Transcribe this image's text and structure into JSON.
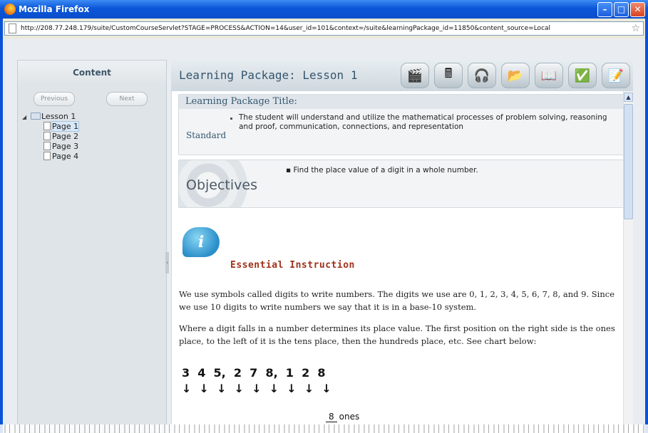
{
  "window": {
    "title": "Mozilla Firefox",
    "minimize": "–",
    "maximize": "□",
    "close": "✕"
  },
  "address_bar": {
    "url": "http://208.77.248.179/suite/CustomCourseServlet?STAGE=PROCESS&ACTION=14&user_id=101&context=/suite&learningPackage_id=11850&content_source=Local"
  },
  "sidebar": {
    "heading": "Content",
    "previous_label": "Previous",
    "next_label": "Next",
    "tree": {
      "lesson": "Lesson 1",
      "pages": [
        "Page 1",
        "Page 2",
        "Page 3",
        "Page 4"
      ],
      "selected_page": "Page 1"
    }
  },
  "header": {
    "title": "Learning Package: Lesson 1",
    "tools": [
      "clapperboard-icon",
      "calculator-icon",
      "headphones-icon",
      "folder-icon",
      "book-pdf-icon",
      "check-mail-icon",
      "notepad-icon"
    ]
  },
  "standard_card": {
    "title": "Learning Package Title:",
    "label": "Standard",
    "text": "The student will understand and utilize the mathematical processes of problem solving, reasoning and proof, communication, connections, and representation"
  },
  "objectives_card": {
    "label": "Objectives",
    "items": [
      "Find the place value of a digit in a whole number."
    ]
  },
  "instruction": {
    "heading": "Essential Instruction",
    "paragraph1": "We use symbols called digits to write numbers.  The digits we use are 0, 1, 2, 3, 4, 5, 6, 7, 8, and 9.  Since we use 10 digits to write numbers we say that it is in a base-10 system.",
    "paragraph2": "Where a digit falls in a number determines its place value.  The first position on the right side is the ones place, to the left of it is the tens place, then the hundreds place, etc. See chart below:",
    "number_display": "3  4  5,  2  7  8,  1  2  8",
    "arrows_display": "↓  ↓  ↓  ↓  ↓  ↓  ↓  ↓  ↓",
    "ones_digit": "8",
    "ones_label": "ones"
  },
  "colors": {
    "title_bar": "#0a56d8",
    "header_text": "#35566e",
    "heading_red": "#a0301a"
  }
}
